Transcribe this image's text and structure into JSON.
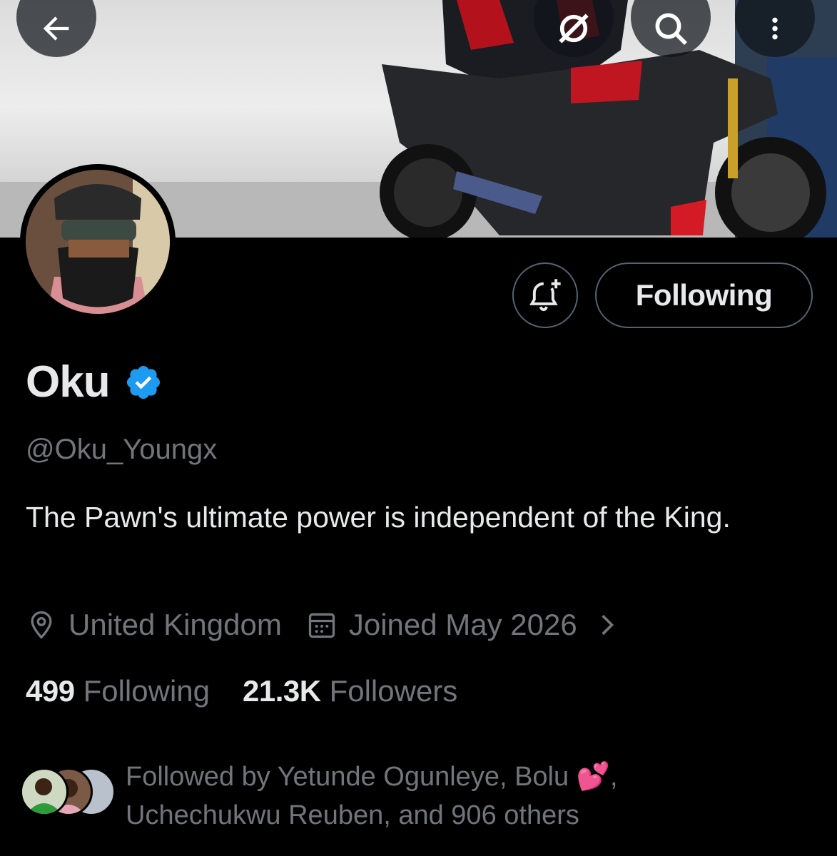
{
  "banner": {
    "description_icon": "motorcycle-banner"
  },
  "nav": {
    "back_icon": "arrow-left-icon",
    "mute_icon": "mute-icon",
    "search_icon": "search-icon",
    "more_icon": "more-vertical-icon"
  },
  "profile": {
    "display_name": "Oku",
    "handle": "@Oku_Youngx",
    "bio": "The Pawn's ultimate power is independent of the King.",
    "location": "United Kingdom",
    "joined": "Joined May 2026",
    "following_count": "499",
    "following_label": "Following",
    "followers_count": "21.3K",
    "followers_label": "Followers",
    "verified_color": "#1d9bf0"
  },
  "actions": {
    "follow_button_label": "Following",
    "notify_icon": "bell-plus-icon"
  },
  "followed_by": {
    "text_prefix": "Followed by Yetunde Ogunleye, Bolu ",
    "emoji": "💕",
    "text_suffix": ", Uchechukwu Reuben, and 906 others"
  },
  "colors": {
    "background": "#000000",
    "primary_text": "#e7e9ea",
    "secondary_text": "#71767b",
    "border": "#536471",
    "accent": "#1d9bf0"
  }
}
